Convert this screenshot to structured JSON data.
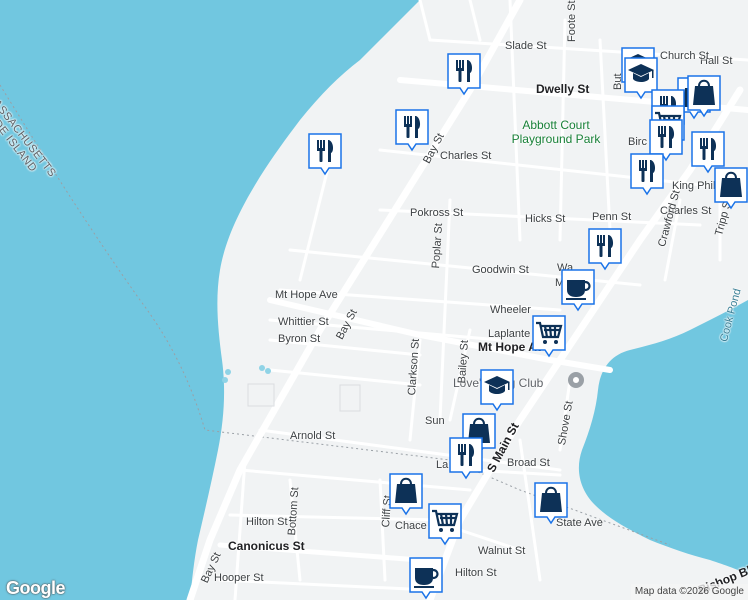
{
  "map": {
    "attribution": "Map data ©2026 Google",
    "logo": "Google",
    "colors": {
      "water": "#71c7e0",
      "land": "#f1f3f4",
      "road": "#ffffff",
      "marker_fill": "#ffffff",
      "marker_border": "#1a73e8",
      "icon": "#0d3157",
      "park_text": "#188038"
    },
    "boundary_label": "MASSACHUSETTS\nRHODE ISLAND",
    "park_label": "Abbott Court Playground Park",
    "poi_label": "Love's Ring Club",
    "water_label": "Cook Pond",
    "street_labels": [
      "Slade St",
      "Foote St",
      "Hall St",
      "Dwelly St",
      "Charles St",
      "Bay St",
      "King Phil",
      "Pokross St",
      "Hicks St",
      "Penn St",
      "Charles St",
      "Poplar St",
      "Goodwin St",
      "Crawford St",
      "Tripp St",
      "Mt Hope Ave",
      "Whittier St",
      "Bay St",
      "Wheeler",
      "Laplante",
      "Byron St",
      "Mt Hope Ave",
      "Clarkson St",
      "Bailey St",
      "S Main St",
      "Shove St",
      "Arnold St",
      "Broad St",
      "Sun",
      "La",
      "Hilton St",
      "Bottom St",
      "Cliff St",
      "Chace",
      "Walnut St",
      "State Ave",
      "Canonicus St",
      "Hilton St",
      "Bay St",
      "Hooper St",
      "Bishop Blvd",
      "Birc",
      "But",
      "Church St",
      "Wa",
      "Ma"
    ],
    "markers": [
      {
        "type": "restaurant",
        "icon": "fork-knife-icon"
      },
      {
        "type": "restaurant",
        "icon": "fork-knife-icon"
      },
      {
        "type": "restaurant",
        "icon": "fork-knife-icon"
      },
      {
        "type": "school",
        "icon": "graduation-cap-icon"
      },
      {
        "type": "school",
        "icon": "graduation-cap-icon"
      },
      {
        "type": "shop",
        "icon": "shopping-bag-icon"
      },
      {
        "type": "shop",
        "icon": "shopping-bag-icon"
      },
      {
        "type": "restaurant",
        "icon": "fork-knife-icon"
      },
      {
        "type": "grocery",
        "icon": "shopping-cart-icon"
      },
      {
        "type": "restaurant",
        "icon": "fork-knife-icon"
      },
      {
        "type": "restaurant",
        "icon": "fork-knife-icon"
      },
      {
        "type": "restaurant",
        "icon": "fork-knife-icon"
      },
      {
        "type": "shop",
        "icon": "shopping-bag-icon"
      },
      {
        "type": "restaurant",
        "icon": "fork-knife-icon"
      },
      {
        "type": "cafe",
        "icon": "coffee-cup-icon"
      },
      {
        "type": "grocery",
        "icon": "shopping-cart-icon"
      },
      {
        "type": "school",
        "icon": "graduation-cap-icon"
      },
      {
        "type": "shop",
        "icon": "shopping-bag-icon"
      },
      {
        "type": "restaurant",
        "icon": "fork-knife-icon"
      },
      {
        "type": "shop",
        "icon": "shopping-bag-icon"
      },
      {
        "type": "grocery",
        "icon": "shopping-cart-icon"
      },
      {
        "type": "shop",
        "icon": "shopping-bag-icon"
      },
      {
        "type": "cafe",
        "icon": "coffee-cup-icon"
      }
    ]
  }
}
